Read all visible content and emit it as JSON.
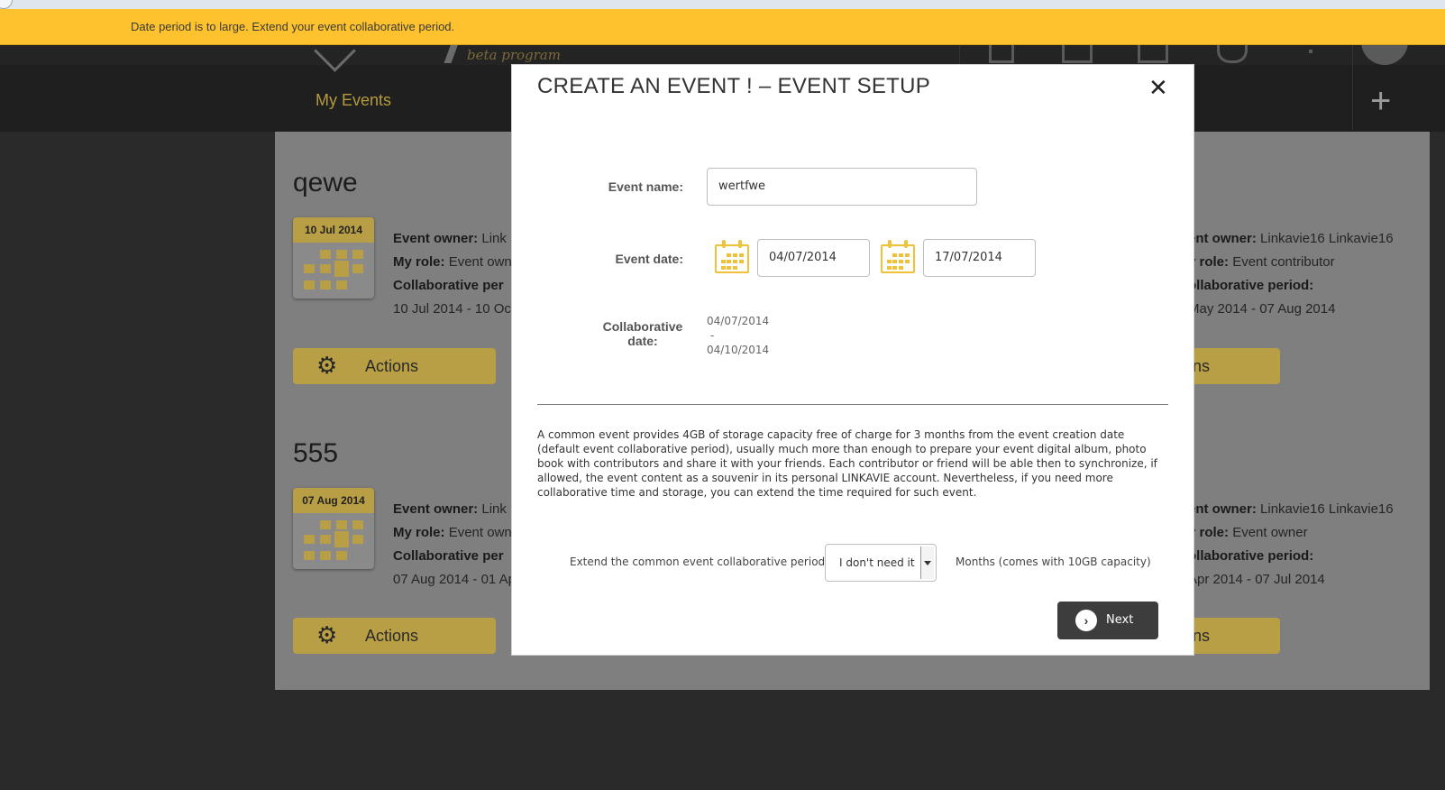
{
  "notification": {
    "message": "Date period is to large. Extend your event collaborative period."
  },
  "header": {
    "beta": "beta program",
    "nav_my_events": "My Events",
    "add_glyph": "+"
  },
  "events": [
    {
      "title": "qewe",
      "date": "10 Jul 2014",
      "owner_label": "Event owner:",
      "owner_value": "Link",
      "role_label": "My role:",
      "role_value": "Event own",
      "period_label": "Collaborative per",
      "period_value": "10 Jul 2014 - 10 Oct",
      "actions_label": "Actions",
      "right_owner_label": "ent owner:",
      "right_owner_value": "Linkavie16 Linkavie16",
      "right_role_label": "y role:",
      "right_role_value": "Event contributor",
      "right_period_label": "ollaborative period:",
      "right_period_value": "May 2014 - 07 Aug 2014",
      "right_actions_label": "ns"
    },
    {
      "title": "555",
      "date": "07 Aug 2014",
      "owner_label": "Event owner:",
      "owner_value": "Link",
      "role_label": "My role:",
      "role_value": "Event own",
      "period_label": "Collaborative per",
      "period_value": "07 Aug 2014 - 01 Ap",
      "actions_label": "Actions",
      "right_owner_label": "ent owner:",
      "right_owner_value": "Linkavie16 Linkavie16",
      "right_role_label": "y role:",
      "right_role_value": "Event owner",
      "right_period_label": "ollaborative period:",
      "right_period_value": "Apr 2014 - 07 Jul 2014",
      "right_actions_label": "ns"
    }
  ],
  "modal": {
    "title": "CREATE AN EVENT ! – EVENT SETUP",
    "close_glyph": "✕",
    "event_name_label": "Event name:",
    "event_name_value": "wertfwe",
    "event_date_label": "Event date:",
    "start_date": "04/07/2014",
    "end_date": "17/07/2014",
    "collab_label_1": "Collaborative",
    "collab_label_2": "date:",
    "collab_start": "04/07/2014",
    "collab_sep": "-",
    "collab_end": "04/10/2014",
    "description": "A common event provides 4GB of storage capacity free of charge for 3 months from the event creation date (default event collaborative period), usually much more than enough to prepare your event digital album, photo book with contributors and share it with your friends. Each contributor or friend will be able then to synchronize, if allowed, the event content as a souvenir in its personal LINKAVIE account. Nevertheless, if you need more collaborative time and storage, you can extend the time required for such event.",
    "extend_label": "Extend the common event collaborative period:",
    "extend_selected": "I don't need it",
    "months_label": "Months (comes with 10GB capacity)",
    "next_label": "Next",
    "next_glyph": "›"
  }
}
